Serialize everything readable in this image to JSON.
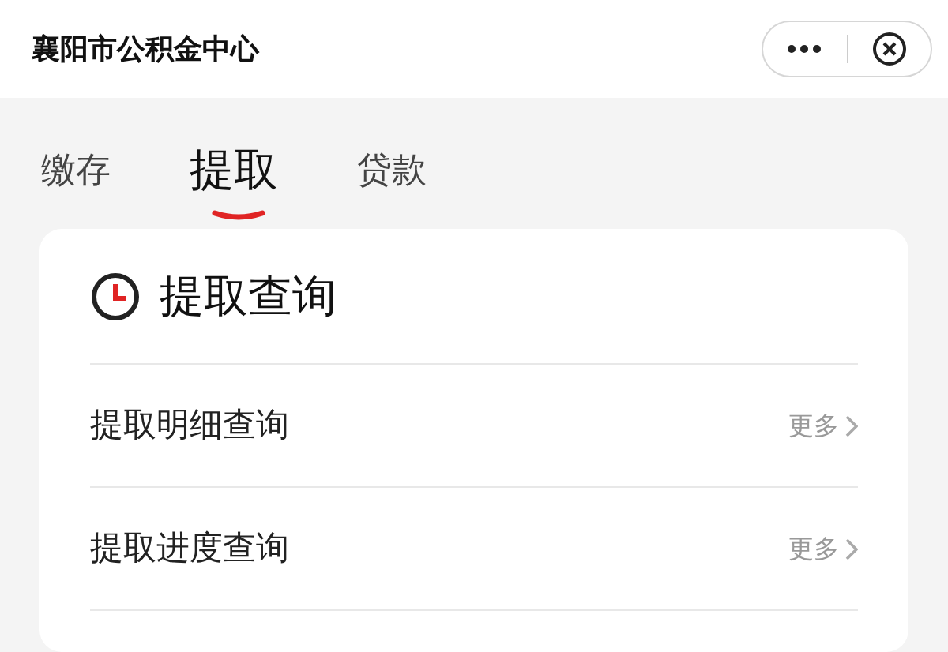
{
  "header": {
    "title": "襄阳市公积金中心"
  },
  "tabs": [
    {
      "label": "缴存",
      "selected": false
    },
    {
      "label": "提取",
      "selected": true
    },
    {
      "label": "贷款",
      "selected": false
    }
  ],
  "card": {
    "title": "提取查询",
    "rows": [
      {
        "label": "提取明细查询",
        "more": "更多"
      },
      {
        "label": "提取进度查询",
        "more": "更多"
      }
    ]
  }
}
